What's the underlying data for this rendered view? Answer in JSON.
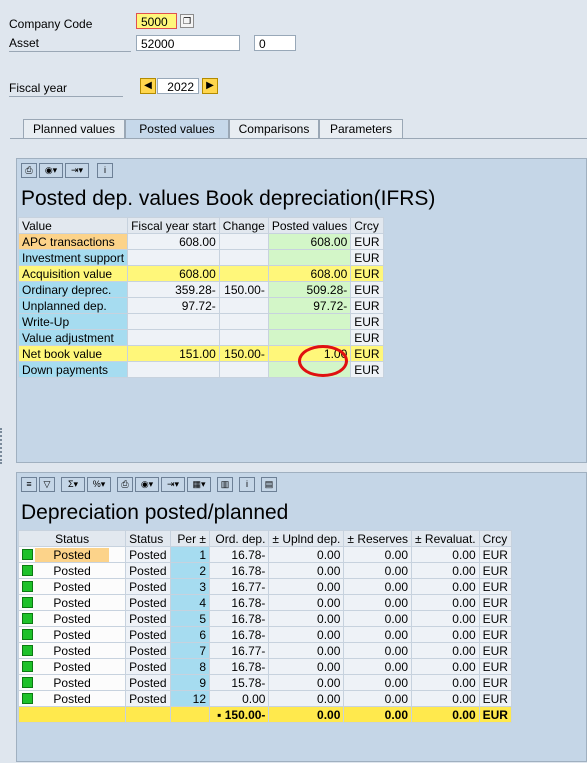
{
  "header": {
    "company_code_label": "Company Code",
    "company_code_value": "5000",
    "asset_label": "Asset",
    "asset_value": "52000",
    "asset_sub_value": "0",
    "fiscal_year_label": "Fiscal year",
    "fiscal_year_value": "2022"
  },
  "tabs": [
    {
      "label": "Planned values",
      "active": false
    },
    {
      "label": "Posted values",
      "active": true
    },
    {
      "label": "Comparisons",
      "active": false
    },
    {
      "label": "Parameters",
      "active": false
    }
  ],
  "panel1": {
    "title": "Posted dep. values Book depreciation(IFRS)",
    "columns": [
      "Value",
      "Fiscal year start",
      "Change",
      "Posted values",
      "Crcy"
    ],
    "rows": [
      {
        "label": "APC transactions",
        "start": "608.00",
        "change": "",
        "posted": "608.00",
        "crcy": "EUR"
      },
      {
        "label": "Investment support",
        "start": "",
        "change": "",
        "posted": "",
        "crcy": "EUR"
      },
      {
        "label": "Acquisition value",
        "start": "608.00",
        "change": "",
        "posted": "608.00",
        "crcy": "EUR"
      },
      {
        "label": "Ordinary deprec.",
        "start": "359.28-",
        "change": "150.00-",
        "posted": "509.28-",
        "crcy": "EUR"
      },
      {
        "label": "Unplanned dep.",
        "start": "97.72-",
        "change": "",
        "posted": "97.72-",
        "crcy": "EUR"
      },
      {
        "label": "Write-Up",
        "start": "",
        "change": "",
        "posted": "",
        "crcy": "EUR"
      },
      {
        "label": "Value adjustment",
        "start": "",
        "change": "",
        "posted": "",
        "crcy": "EUR"
      },
      {
        "label": "Net book value",
        "start": "151.00",
        "change": "150.00-",
        "posted": "1.00",
        "crcy": "EUR"
      },
      {
        "label": "Down payments",
        "start": "",
        "change": "",
        "posted": "",
        "crcy": "EUR"
      }
    ]
  },
  "panel2": {
    "title": "Depreciation posted/planned",
    "columns": [
      "Status",
      "Status",
      "Per",
      "Ord. dep.",
      "Uplnd dep.",
      "Reserves",
      "Revaluat.",
      "Crcy"
    ],
    "rows": [
      {
        "status": "Posted",
        "status2": "Posted",
        "per": "1",
        "ord": "16.78-",
        "upl": "0.00",
        "res": "0.00",
        "rev": "0.00",
        "crcy": "EUR"
      },
      {
        "status": "Posted",
        "status2": "Posted",
        "per": "2",
        "ord": "16.78-",
        "upl": "0.00",
        "res": "0.00",
        "rev": "0.00",
        "crcy": "EUR"
      },
      {
        "status": "Posted",
        "status2": "Posted",
        "per": "3",
        "ord": "16.77-",
        "upl": "0.00",
        "res": "0.00",
        "rev": "0.00",
        "crcy": "EUR"
      },
      {
        "status": "Posted",
        "status2": "Posted",
        "per": "4",
        "ord": "16.78-",
        "upl": "0.00",
        "res": "0.00",
        "rev": "0.00",
        "crcy": "EUR"
      },
      {
        "status": "Posted",
        "status2": "Posted",
        "per": "5",
        "ord": "16.78-",
        "upl": "0.00",
        "res": "0.00",
        "rev": "0.00",
        "crcy": "EUR"
      },
      {
        "status": "Posted",
        "status2": "Posted",
        "per": "6",
        "ord": "16.78-",
        "upl": "0.00",
        "res": "0.00",
        "rev": "0.00",
        "crcy": "EUR"
      },
      {
        "status": "Posted",
        "status2": "Posted",
        "per": "7",
        "ord": "16.77-",
        "upl": "0.00",
        "res": "0.00",
        "rev": "0.00",
        "crcy": "EUR"
      },
      {
        "status": "Posted",
        "status2": "Posted",
        "per": "8",
        "ord": "16.78-",
        "upl": "0.00",
        "res": "0.00",
        "rev": "0.00",
        "crcy": "EUR"
      },
      {
        "status": "Posted",
        "status2": "Posted",
        "per": "9",
        "ord": "15.78-",
        "upl": "0.00",
        "res": "0.00",
        "rev": "0.00",
        "crcy": "EUR"
      },
      {
        "status": "Posted",
        "status2": "Posted",
        "per": "12",
        "ord": "0.00",
        "upl": "0.00",
        "res": "0.00",
        "rev": "0.00",
        "crcy": "EUR"
      }
    ],
    "total": {
      "ord": "150.00-",
      "upl": "0.00",
      "res": "0.00",
      "rev": "0.00",
      "crcy": "EUR"
    }
  },
  "colors": {
    "status_green": "#1ec12a",
    "highlight_circle": "#e01010",
    "yellow": "#fff77a"
  }
}
